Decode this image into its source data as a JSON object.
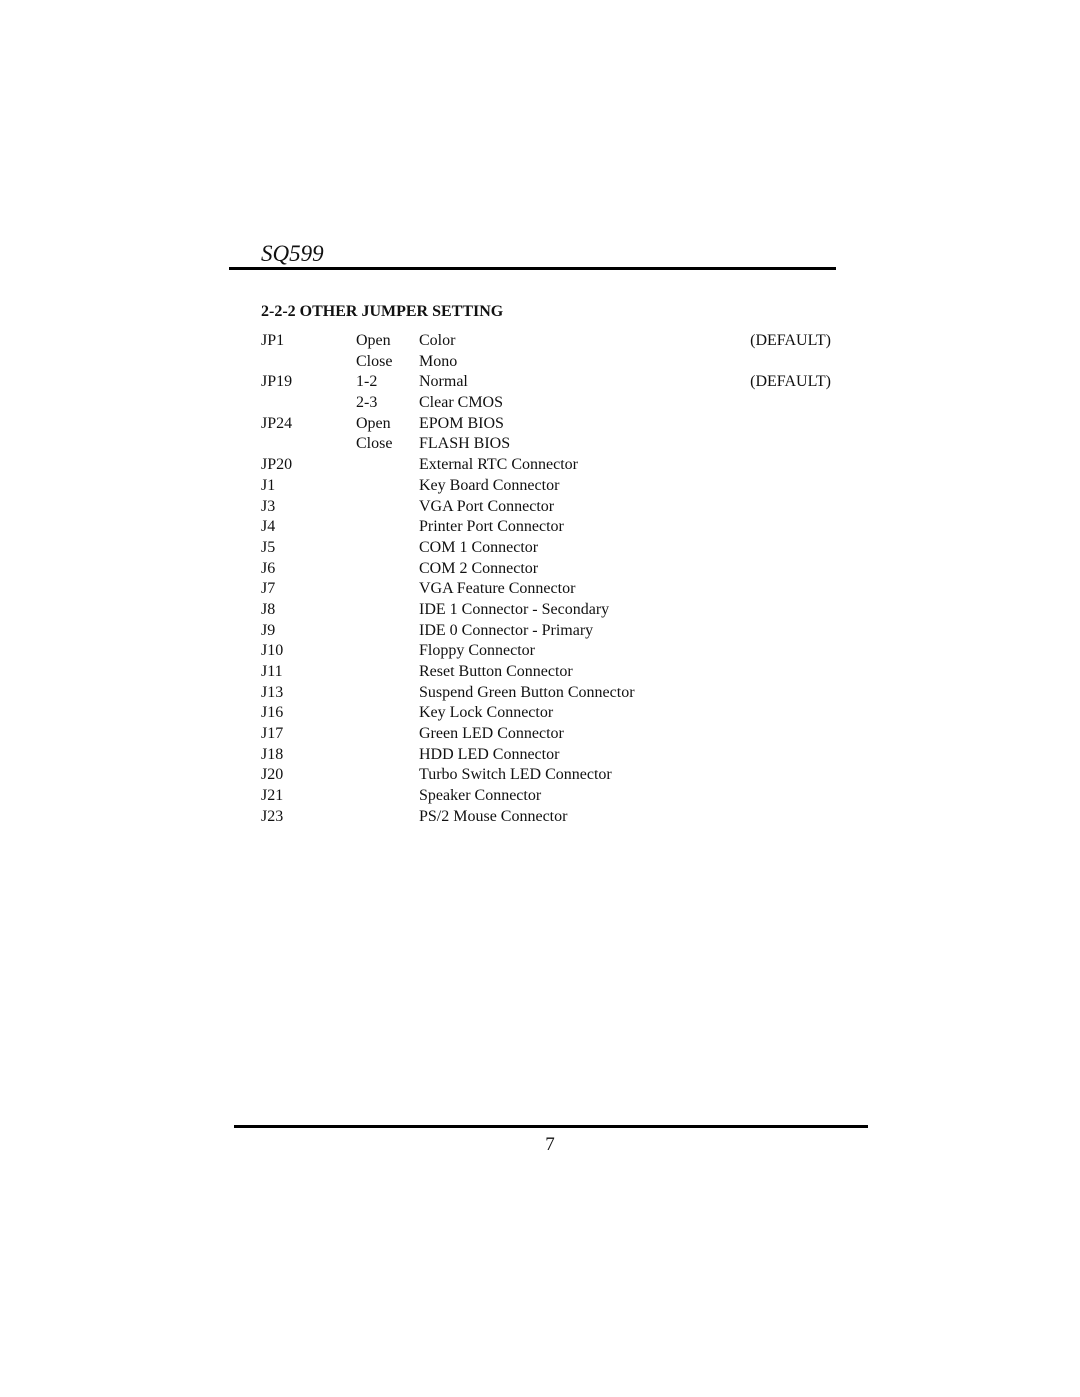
{
  "header": {
    "title": "SQ599"
  },
  "section": {
    "heading": "2-2-2 OTHER JUMPER SETTING"
  },
  "rows": [
    {
      "id": "JP1",
      "setting": "Open",
      "description": "Color",
      "note": "(DEFAULT)"
    },
    {
      "id": "",
      "setting": "Close",
      "description": "Mono",
      "note": ""
    },
    {
      "id": "JP19",
      "setting": "1-2",
      "description": "Normal",
      "note": "(DEFAULT)"
    },
    {
      "id": "",
      "setting": "2-3",
      "description": "Clear CMOS",
      "note": ""
    },
    {
      "id": "JP24",
      "setting": "Open",
      "description": "EPOM BIOS",
      "note": ""
    },
    {
      "id": "",
      "setting": "Close",
      "description": "FLASH BIOS",
      "note": ""
    },
    {
      "id": "JP20",
      "setting": "",
      "description": "External RTC Connector",
      "note": ""
    },
    {
      "id": "J1",
      "setting": "",
      "description": "Key Board Connector",
      "note": ""
    },
    {
      "id": "J3",
      "setting": "",
      "description": "VGA Port Connector",
      "note": ""
    },
    {
      "id": "J4",
      "setting": "",
      "description": "Printer Port Connector",
      "note": ""
    },
    {
      "id": "J5",
      "setting": "",
      "description": "COM 1 Connector",
      "note": ""
    },
    {
      "id": "J6",
      "setting": "",
      "description": "COM 2 Connector",
      "note": ""
    },
    {
      "id": "J7",
      "setting": "",
      "description": "VGA Feature Connector",
      "note": ""
    },
    {
      "id": "J8",
      "setting": "",
      "description": "IDE 1 Connector - Secondary",
      "note": ""
    },
    {
      "id": "J9",
      "setting": "",
      "description": "IDE 0 Connector - Primary",
      "note": ""
    },
    {
      "id": "J10",
      "setting": "",
      "description": "Floppy Connector",
      "note": ""
    },
    {
      "id": "J11",
      "setting": "",
      "description": "Reset Button Connector",
      "note": ""
    },
    {
      "id": "J13",
      "setting": "",
      "description": "Suspend Green Button Connector",
      "note": ""
    },
    {
      "id": "J16",
      "setting": "",
      "description": "Key Lock Connector",
      "note": ""
    },
    {
      "id": "J17",
      "setting": "",
      "description": "Green LED Connector",
      "note": ""
    },
    {
      "id": "J18",
      "setting": "",
      "description": "HDD LED Connector",
      "note": ""
    },
    {
      "id": "J20",
      "setting": "",
      "description": "Turbo Switch LED Connector",
      "note": ""
    },
    {
      "id": "J21",
      "setting": "",
      "description": "Speaker Connector",
      "note": ""
    },
    {
      "id": "J23",
      "setting": "",
      "description": "PS/2 Mouse Connector",
      "note": ""
    }
  ],
  "footer": {
    "page_number": "7"
  }
}
